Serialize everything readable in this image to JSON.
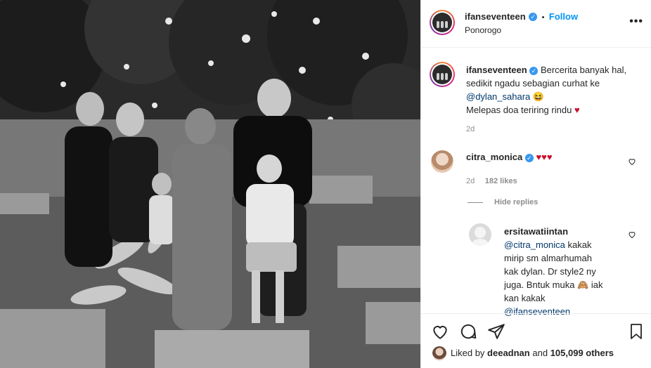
{
  "post": {
    "username": "ifanseventeen",
    "follow_label": "Follow",
    "separator": "•",
    "location": "Ponorogo",
    "more_label": "•••"
  },
  "caption": {
    "username": "ifanseventeen",
    "line1": "Bercerita banyak hal,",
    "line2": "sedikit ngadu sebagian curhat ke",
    "mention": "@dylan_sahara",
    "emoji": "😆",
    "line3": "Melepas doa teriring rindu",
    "heart": "♥",
    "time": "2d"
  },
  "comment1": {
    "username": "citra_monica",
    "text": "♥♥♥",
    "time": "2d",
    "likes": "182 likes",
    "hide_replies": "Hide replies"
  },
  "reply1": {
    "username": "ersitawatiintan",
    "mention": "@citra_monica",
    "line1_rest": " kakak",
    "line2": "mirip sm almarhumah",
    "line3": "kak dylan. Dr style2 ny",
    "line4": "juga. Bntuk muka",
    "emoji": "🙈",
    "line4_rest": " iak",
    "line5": "kan kakak",
    "mention2": "@ifanseventeen"
  },
  "footer": {
    "liked_by_prefix": "Liked by",
    "liked_by_user": "deeadnan",
    "liked_by_and": "and",
    "liked_by_count": "105,099 others"
  },
  "colors": {
    "accent": "#0095f6",
    "heart": "#c8102e",
    "verified": "#3897f0"
  }
}
